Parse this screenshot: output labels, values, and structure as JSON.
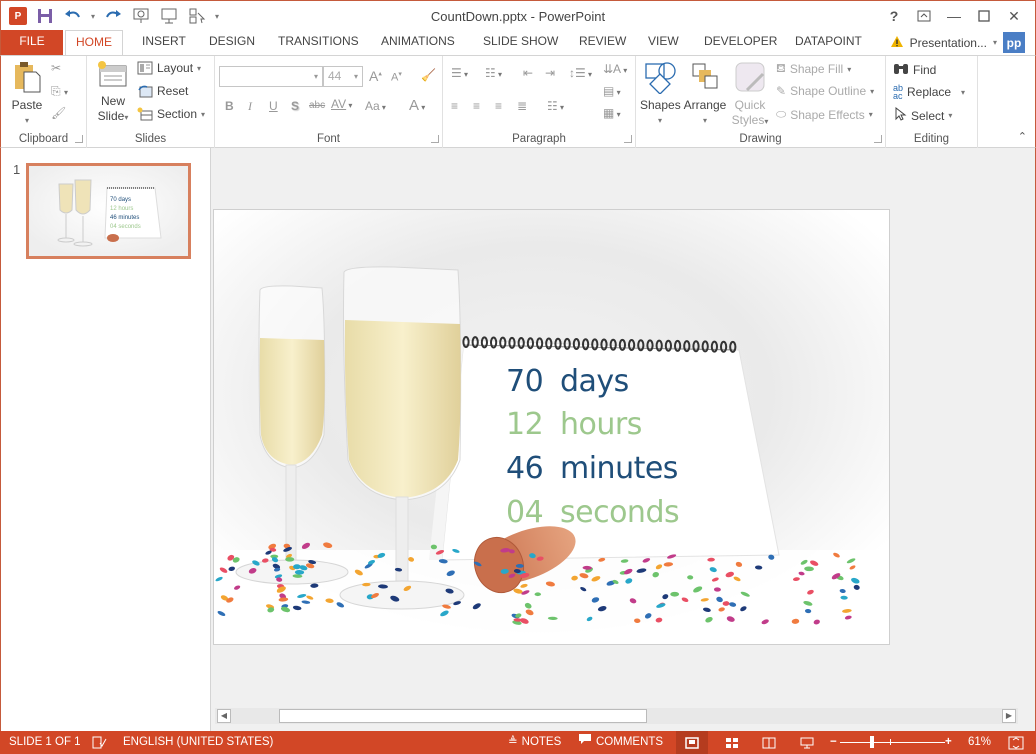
{
  "window": {
    "title": "CountDown.pptx - PowerPoint",
    "app_logo": "P",
    "controls": [
      "?",
      "restore-ribbon",
      "minimize",
      "maximize",
      "close"
    ]
  },
  "qat": {
    "icons": [
      "save-icon",
      "undo-icon",
      "redo-icon",
      "start-from-beginning-icon",
      "present-online-icon",
      "touch-mode-icon",
      "customize-qat-icon"
    ]
  },
  "tabs": {
    "items": [
      {
        "label": "FILE"
      },
      {
        "label": "HOME"
      },
      {
        "label": "INSERT"
      },
      {
        "label": "DESIGN"
      },
      {
        "label": "TRANSITIONS"
      },
      {
        "label": "ANIMATIONS"
      },
      {
        "label": "SLIDE SHOW"
      },
      {
        "label": "REVIEW"
      },
      {
        "label": "VIEW"
      },
      {
        "label": "DEVELOPER"
      },
      {
        "label": "DATAPOINT"
      }
    ],
    "active": "HOME",
    "account_label": "Presentation...",
    "account_badge": "pp",
    "warning_color": "#f0b400"
  },
  "ribbon": {
    "clipboard": {
      "label": "Clipboard",
      "paste": "Paste"
    },
    "slides": {
      "label": "Slides",
      "new_slide_line1": "New",
      "new_slide_line2": "Slide",
      "layout": "Layout",
      "reset": "Reset",
      "section": "Section"
    },
    "font": {
      "label": "Font",
      "font_name": "",
      "font_size": "44",
      "bold": "B",
      "italic": "I",
      "underline": "U",
      "shadow": "S",
      "strikethrough": "abc",
      "spacing": "AV",
      "case": "Aa",
      "color": "A",
      "grow": "A",
      "shrink": "A"
    },
    "paragraph": {
      "label": "Paragraph"
    },
    "drawing": {
      "label": "Drawing",
      "shapes": "Shapes",
      "arrange": "Arrange",
      "quick_line1": "Quick",
      "quick_line2": "Styles",
      "shape_fill": "Shape Fill",
      "shape_outline": "Shape Outline",
      "shape_effects": "Shape Effects"
    },
    "editing": {
      "label": "Editing",
      "find": "Find",
      "replace": "Replace",
      "select": "Select"
    }
  },
  "thumbnails": [
    {
      "number": "1",
      "lines": [
        {
          "num": "70",
          "unit": "days"
        },
        {
          "num": "12",
          "unit": "hours"
        },
        {
          "num": "46",
          "unit": "minutes"
        },
        {
          "num": "04",
          "unit": "seconds"
        }
      ]
    }
  ],
  "slide": {
    "countdown": [
      {
        "num": "70",
        "unit": "days",
        "color": "#1f4e79"
      },
      {
        "num": "12",
        "unit": "hours",
        "color": "#9dc88d"
      },
      {
        "num": "46",
        "unit": "minutes",
        "color": "#1f4e79"
      },
      {
        "num": "04",
        "unit": "seconds",
        "color": "#9dc88d"
      }
    ]
  },
  "statusbar": {
    "slide_indicator": "SLIDE 1 OF 1",
    "language": "ENGLISH (UNITED STATES)",
    "notes": "NOTES",
    "comments": "COMMENTS",
    "zoom_level": "61%",
    "zoom_fraction": 0.3,
    "active_view": "normal"
  },
  "colors": {
    "accent": "#d24726",
    "status_bar": "#d24726",
    "thumb_border": "#d7805e"
  }
}
